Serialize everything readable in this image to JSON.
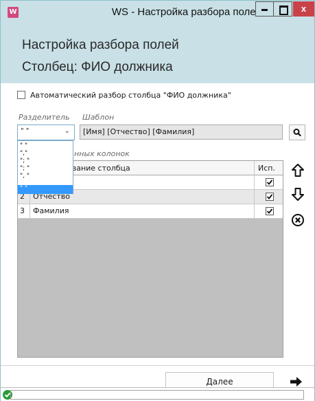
{
  "window": {
    "app_icon": "W",
    "title": "WS - Настройка разбора полей",
    "close_glyph": "x"
  },
  "header": {
    "title": "Настройка разбора полей",
    "subtitle": "Столбец: ФИО должника"
  },
  "auto_parse": {
    "label": "Автоматический разбор столбца \"ФИО должника\"",
    "checked": false
  },
  "separator": {
    "label": "Разделитель",
    "value": "\" \"",
    "options": [
      "\" \"",
      "\",\"",
      "\"; \"",
      "\"; \"",
      "\", \"",
      "\" \""
    ],
    "selected_index": 5
  },
  "template": {
    "label": "Шаблон",
    "value": "[Имя] [Отчество] [Фамилия]"
  },
  "columns_section": {
    "label_visible": "нных колонок"
  },
  "table": {
    "headers": {
      "name": "ование столбца",
      "use": "Исп."
    },
    "rows": [
      {
        "num": "",
        "name": "",
        "used": true
      },
      {
        "num": "2",
        "name": "Отчество",
        "used": true
      },
      {
        "num": "3",
        "name": "Фамилия",
        "used": true
      }
    ]
  },
  "footer": {
    "next_label": "Далее"
  },
  "icons": {
    "search": "search-icon",
    "up": "arrow-up-icon",
    "down": "arrow-down-icon",
    "remove": "remove-circle-icon",
    "next": "arrow-right-icon",
    "status": "ok-check-icon"
  },
  "colors": {
    "header_bg": "#c8e0e6",
    "close_red": "#c9424a",
    "selection_blue": "#3399ff",
    "ok_green": "#2b9b37"
  }
}
